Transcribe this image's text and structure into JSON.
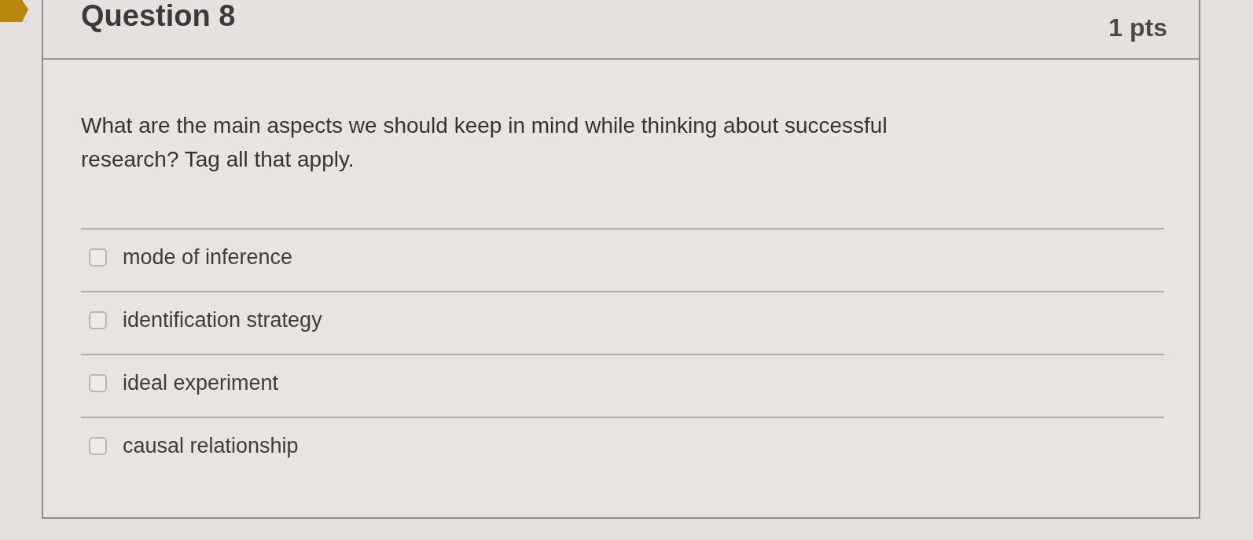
{
  "question": {
    "title": "Question 8",
    "points": "1 pts",
    "text": "What are the main aspects we should keep in mind while thinking about successful research? Tag all that apply.",
    "answers": [
      {
        "label": "mode of inference",
        "checked": false
      },
      {
        "label": "identification strategy",
        "checked": false
      },
      {
        "label": "ideal experiment",
        "checked": false
      },
      {
        "label": "causal relationship",
        "checked": false
      }
    ]
  }
}
